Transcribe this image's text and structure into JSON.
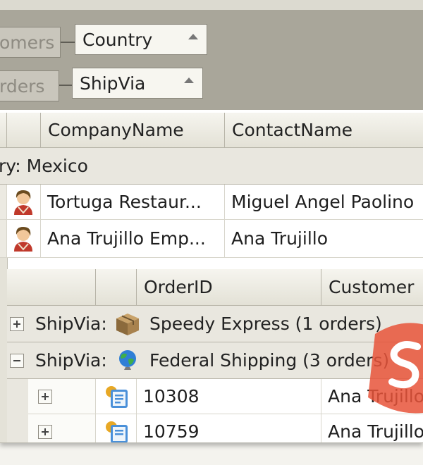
{
  "group_panel": {
    "chip1_faded": "omers",
    "chip1_field": "Country",
    "chip2_faded": "rders",
    "chip2_field": "ShipVia"
  },
  "customers_grid": {
    "columns": [
      "CompanyName",
      "ContactName"
    ],
    "group_label": "ry: Mexico",
    "rows": [
      {
        "company": "Tortuga Restaur...",
        "contact": "Miguel Angel Paolino"
      },
      {
        "company": "Ana Trujillo Emp...",
        "contact": "Ana Trujillo"
      }
    ]
  },
  "orders_grid": {
    "columns": [
      "OrderID",
      "Customer"
    ],
    "groups": [
      {
        "prefix": "ShipVia:",
        "label": "Speedy Express (1 orders)",
        "expanded": false
      },
      {
        "prefix": "ShipVia:",
        "label": "Federal Shipping (3 orders)",
        "expanded": true
      }
    ],
    "rows": [
      {
        "order_id": "10308",
        "customer": "Ana Trujillo"
      },
      {
        "order_id": "10759",
        "customer": "Ana Trujillo"
      }
    ]
  },
  "icons": {
    "customer": "person-icon",
    "speedy": "package-box-icon",
    "federal": "globe-icon",
    "order": "order-form-icon"
  },
  "colors": {
    "group_panel": "#a9a69a",
    "header": "#e3e1d6",
    "group_row": "#e9e7df",
    "logo": "#e8543a"
  }
}
